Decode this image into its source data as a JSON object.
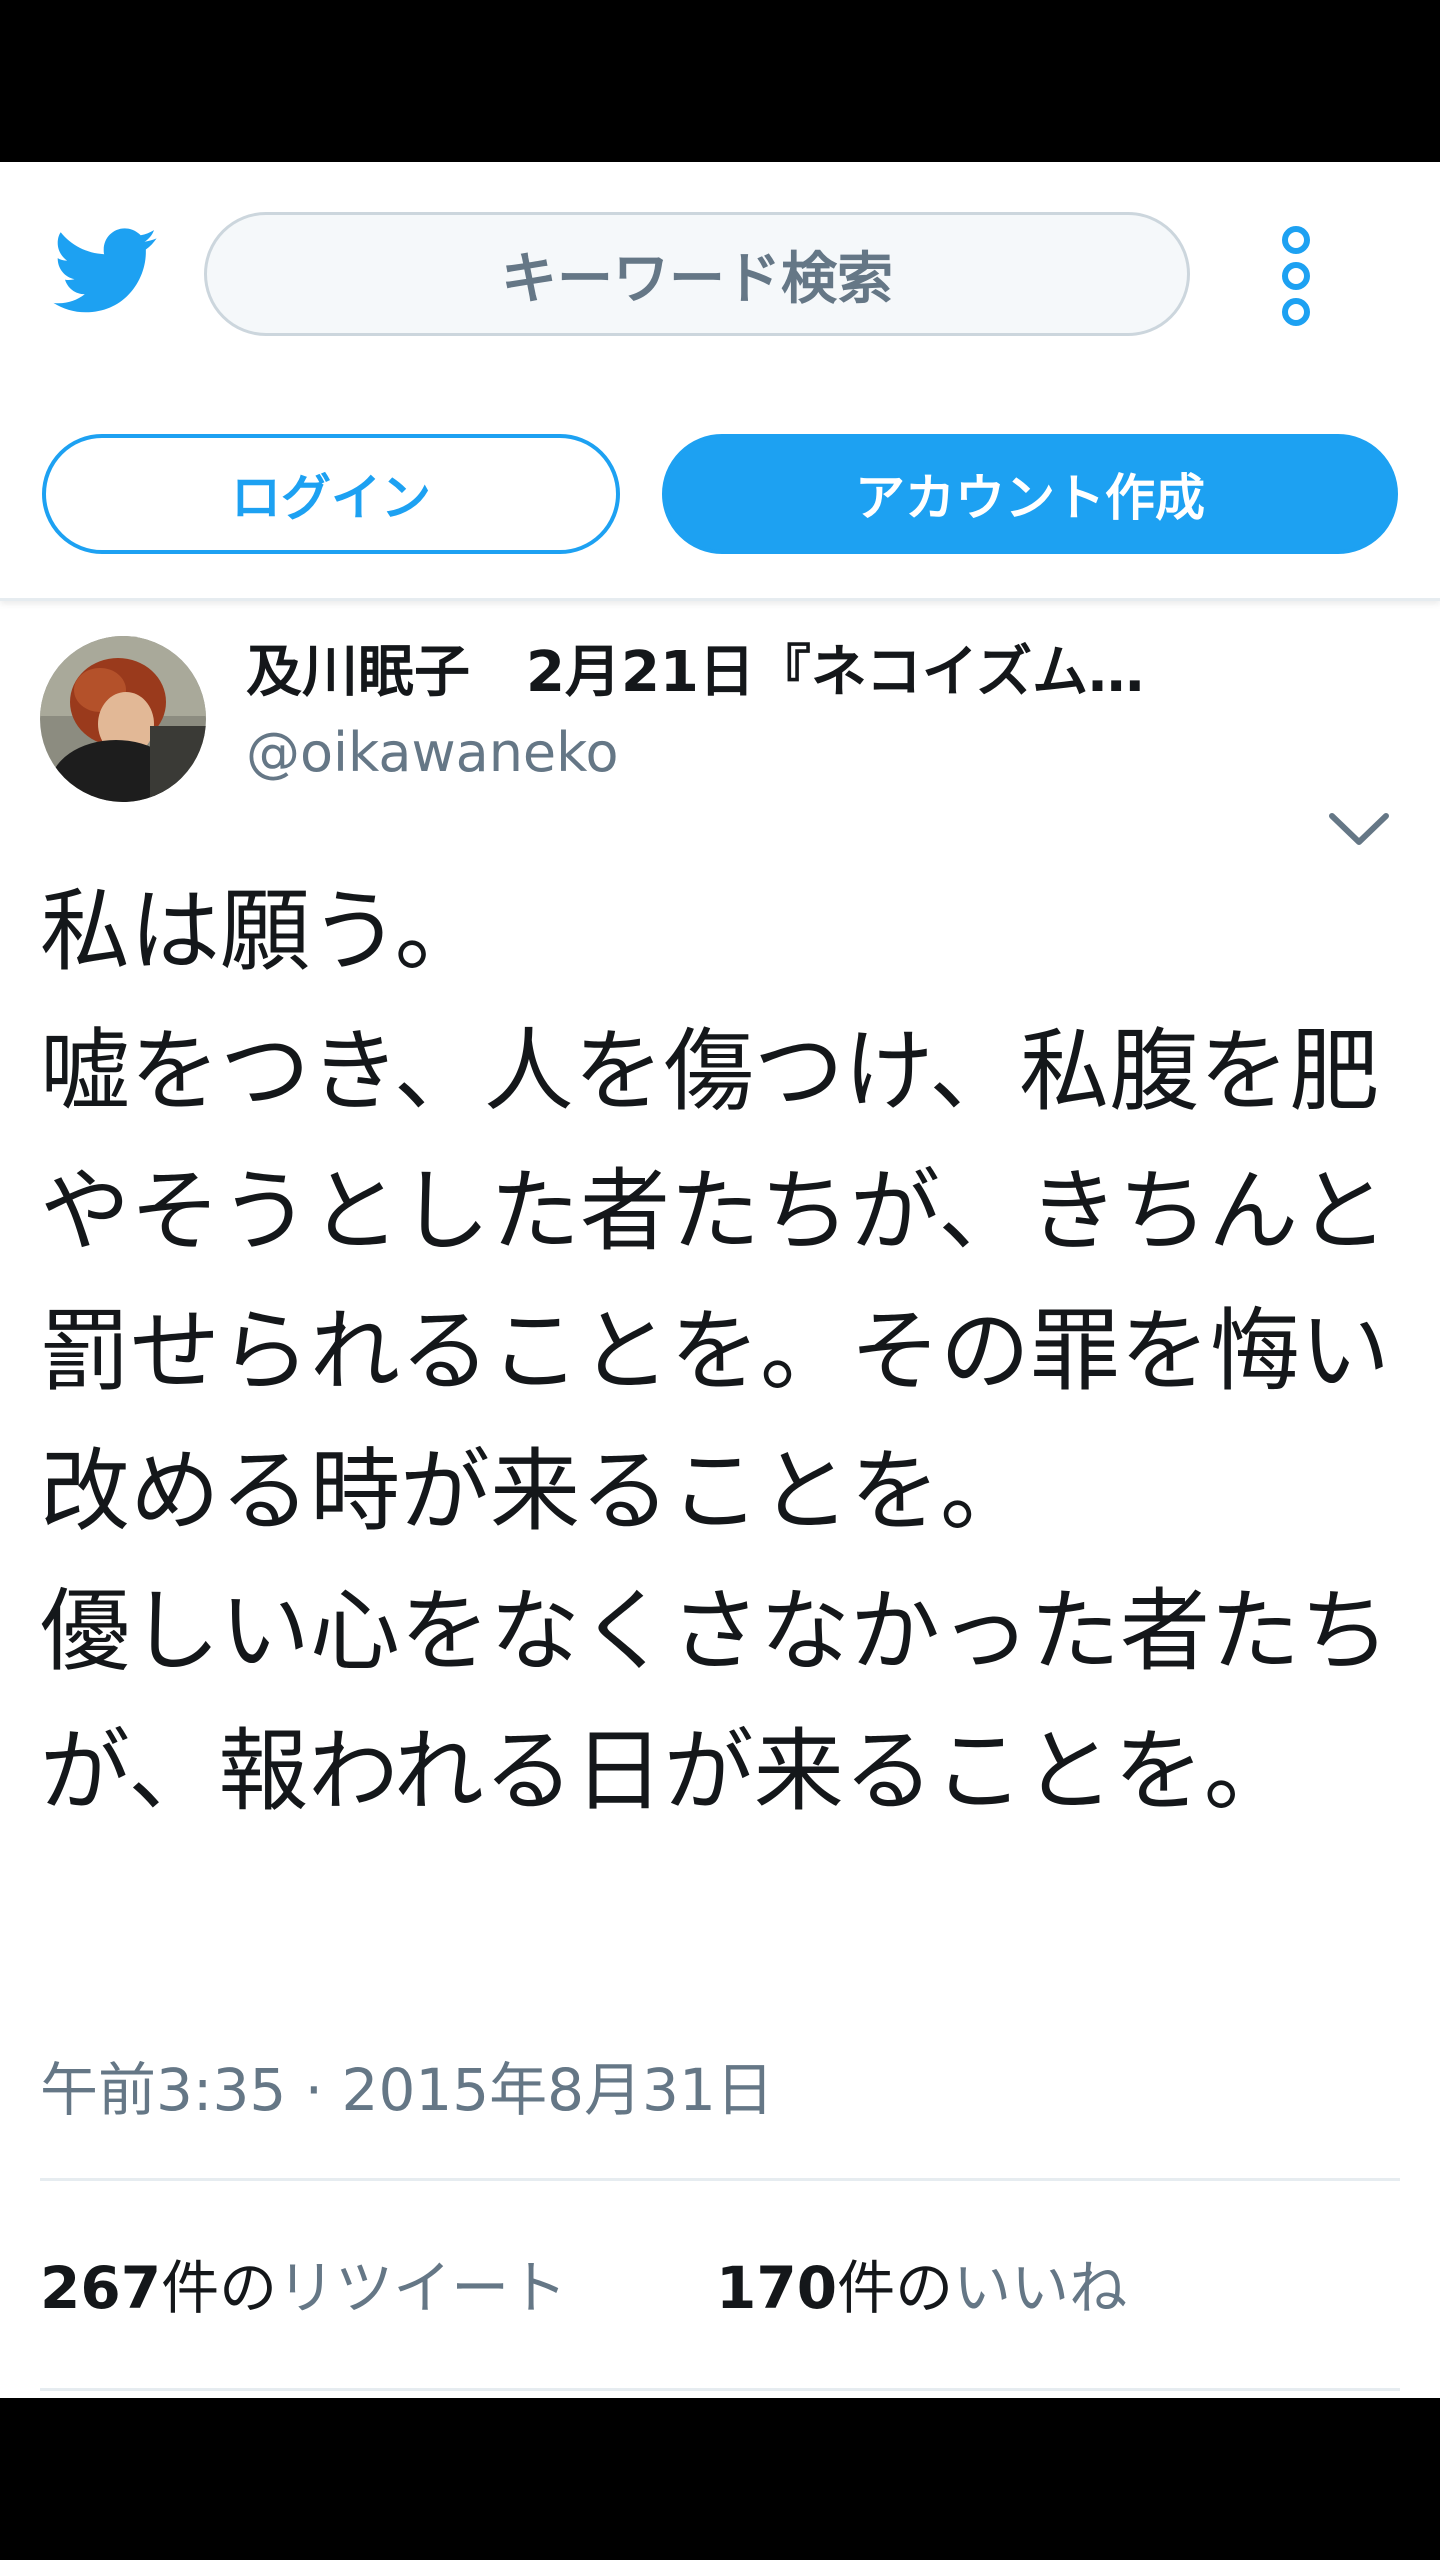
{
  "header": {
    "logo_icon": "twitter-bird-icon",
    "search_placeholder": "キーワード検索",
    "more_icon": "more-vertical-icon",
    "login_label": "ログイン",
    "signup_label": "アカウント作成",
    "accent_color": "#1da1f2"
  },
  "tweet": {
    "author_name": "及川眠子　2月21日『ネコイズム…",
    "author_handle": "@oikawaneko",
    "caret_icon": "chevron-down-icon",
    "text": "私は願う。\n嘘をつき、人を傷つけ、私腹を肥やそうとした者たちが、きちんと罰せられることを。その罪を悔い改める時が来ることを。\n優しい心をなくさなかった者たちが、報われる日が来ることを。",
    "timestamp": "午前3:35 · 2015年8月31日",
    "retweet_count": "267",
    "retweet_count_suffix": "件の",
    "retweet_label": "リツイート",
    "like_count": "170",
    "like_count_suffix": "件の",
    "like_label": "いいね"
  }
}
